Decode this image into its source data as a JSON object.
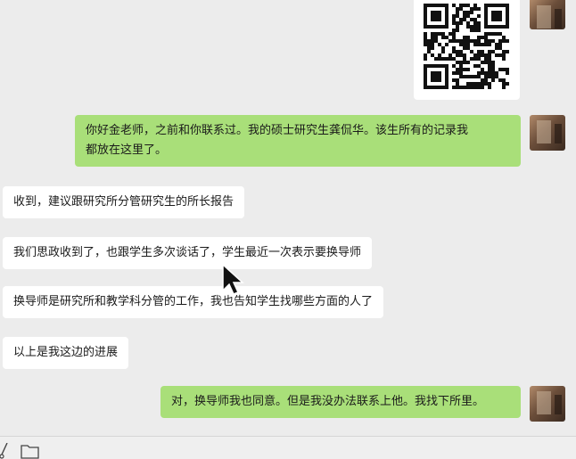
{
  "chat": {
    "messages": [
      {
        "side": "right",
        "type": "image",
        "content": "qr-code-image"
      },
      {
        "side": "right",
        "type": "text",
        "line1": "你好金老师，之前和你联系过。我的硕士研究生龚侃华。该生所有的记录我",
        "line2": "都放在这里了。"
      },
      {
        "side": "left",
        "type": "text",
        "text": "收到，建议跟研究所分管研究生的所长报告"
      },
      {
        "side": "left",
        "type": "text",
        "text": "我们思政收到了，也跟学生多次谈话了，学生最近一次表示要换导师"
      },
      {
        "side": "left",
        "type": "text",
        "text": "换导师是研究所和教学科分管的工作，我也告知学生找哪些方面的人了"
      },
      {
        "side": "left",
        "type": "text",
        "text": "以上是我这边的进展"
      },
      {
        "side": "right",
        "type": "text",
        "text": "对，换导师我也同意。但是我没办法联系上他。我找下所里。"
      }
    ]
  },
  "colors": {
    "background": "#ececec",
    "incoming": "#ffffff",
    "outgoing": "#a9df79"
  },
  "icons": {
    "toolbar": [
      "scissors-icon",
      "folder-icon"
    ],
    "cursor": "mouse-pointer"
  }
}
